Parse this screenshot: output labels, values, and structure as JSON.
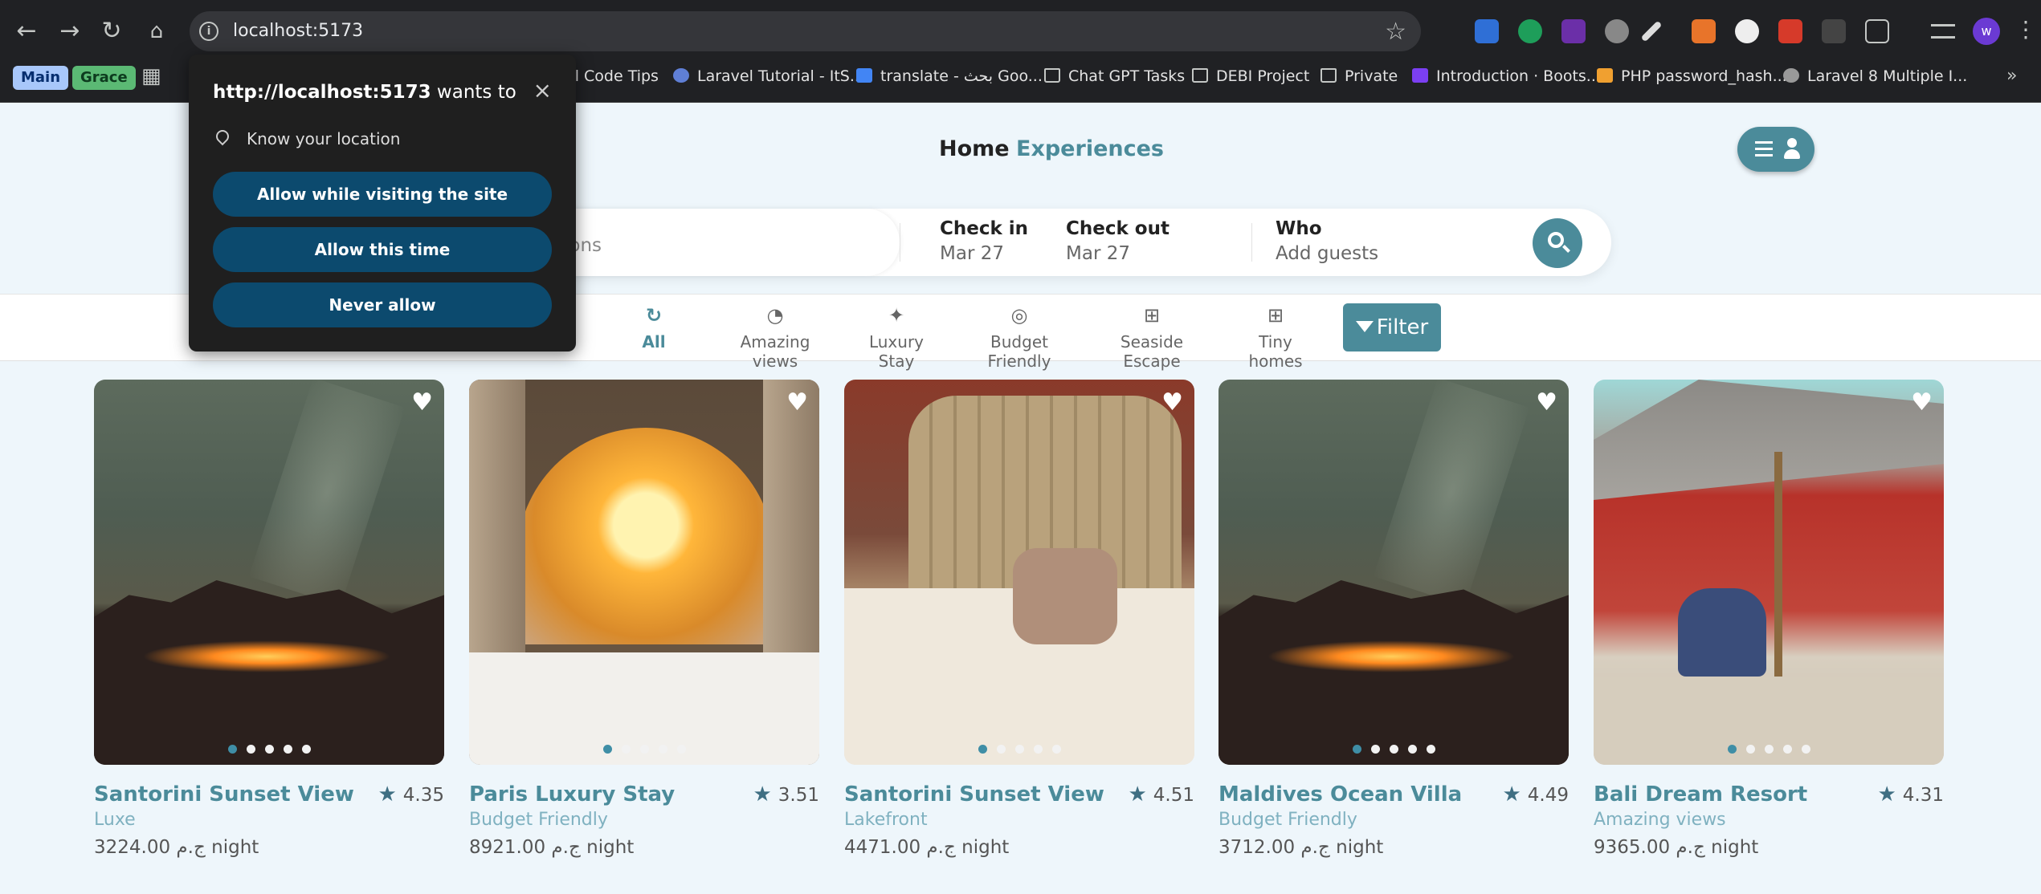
{
  "browser": {
    "url": "localhost:5173",
    "profile_initial": "w",
    "bookmarks": [
      {
        "label": "el Code Tips",
        "icon": "page-icon"
      },
      {
        "label": "Laravel Tutorial - ItS...",
        "icon": "site-icon"
      },
      {
        "label": "translate - بحث Goo...",
        "icon": "google-translate-icon"
      },
      {
        "label": "Chat GPT Tasks",
        "icon": "folder-icon"
      },
      {
        "label": "DEBI Project",
        "icon": "folder-icon"
      },
      {
        "label": "Private",
        "icon": "folder-icon"
      },
      {
        "label": "Introduction · Boots...",
        "icon": "bootstrap-icon"
      },
      {
        "label": "PHP password_hash...",
        "icon": "php-icon"
      },
      {
        "label": "Laravel 8 Multiple I...",
        "icon": "site-icon"
      }
    ],
    "tab_groups": [
      {
        "label": "Main",
        "color": "#a8c7fa"
      },
      {
        "label": "Grace",
        "color": "#5bb974"
      }
    ]
  },
  "permission_prompt": {
    "origin": "http://localhost:5173",
    "suffix": " wants to",
    "request": "Know your location",
    "buttons": {
      "allow_site": "Allow while visiting the site",
      "allow_once": "Allow this time",
      "never": "Never allow"
    }
  },
  "nav": {
    "home": "Home",
    "experiences": "Experiences"
  },
  "search": {
    "where_placeholder": "ions",
    "check_in_label": "Check in",
    "check_in_value": "Mar 27",
    "check_out_label": "Check out",
    "check_out_value": "Mar 27",
    "who_label": "Who",
    "who_value": "Add guests"
  },
  "categories": [
    {
      "label": "All",
      "icon": "refresh-icon",
      "active": true
    },
    {
      "label": "Amazing views",
      "icon": "pie-chart-icon",
      "active": false
    },
    {
      "label": "Luxury Stay",
      "icon": "cursor-click-icon",
      "active": false
    },
    {
      "label": "Budget Friendly",
      "icon": "fingerprint-icon",
      "active": false
    },
    {
      "label": "Seaside Escape",
      "icon": "grid-plus-icon",
      "active": false
    },
    {
      "label": "Tiny homes",
      "icon": "grid-plus-icon",
      "active": false
    }
  ],
  "filter_label": "Filter",
  "colors": {
    "accent": "#4b8b9a",
    "prompt_button": "#0c4a6e",
    "category_text": "#7fb1c0"
  },
  "listings": [
    {
      "title": "Santorini Sunset View",
      "rating": "4.35",
      "category": "Luxe",
      "price": "3224.00 ج.م night",
      "image": "night-sky"
    },
    {
      "title": "Paris Luxury Stay",
      "rating": "3.51",
      "category": "Budget Friendly",
      "price": "8921.00 ج.م night",
      "image": "dome-sunset"
    },
    {
      "title": "Santorini Sunset View",
      "rating": "4.51",
      "category": "Lakefront",
      "price": "4471.00 ج.م night",
      "image": "bed-pillows"
    },
    {
      "title": "Maldives Ocean Villa",
      "rating": "4.49",
      "category": "Budget Friendly",
      "price": "3712.00 ج.م night",
      "image": "night-sky"
    },
    {
      "title": "Bali Dream Resort",
      "rating": "4.31",
      "category": "Amazing views",
      "price": "9365.00 ج.م night",
      "image": "bedouin-tent"
    }
  ]
}
